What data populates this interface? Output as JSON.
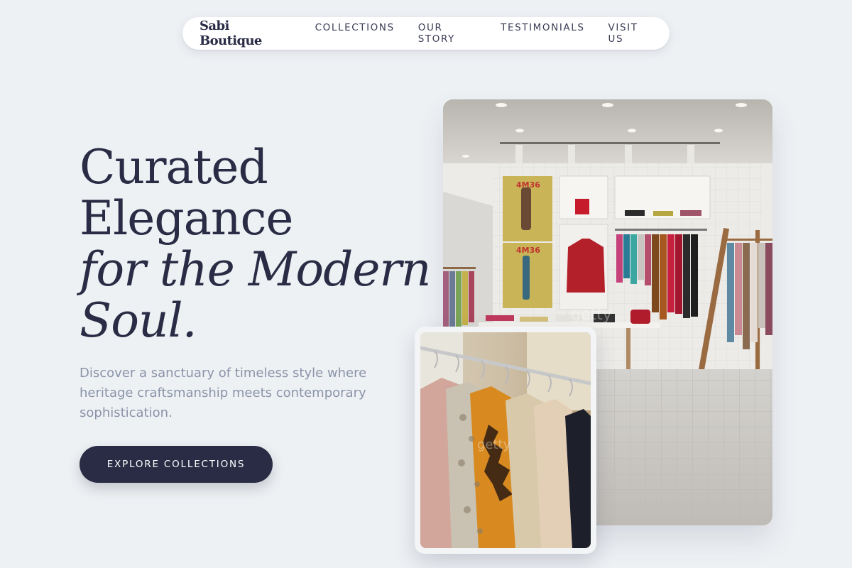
{
  "nav": {
    "brand": "Sabi Boutique",
    "links": [
      "COLLECTIONS",
      "OUR STORY",
      "TESTIMONIALS",
      "VISIT US"
    ]
  },
  "hero": {
    "title_line1": "Curated",
    "title_line2": "Elegance",
    "title_line3": "for the Modern",
    "title_line4": "Soul.",
    "subtitle": "Discover a sanctuary of timeless style where heritage craftsmanship meets contemporary sophistication.",
    "cta_label": "EXPLORE COLLECTIONS"
  },
  "images": {
    "store_poster_text": "4M36",
    "store_alt": "boutique-interior-photo",
    "rack_alt": "clothing-rack-photo"
  },
  "colors": {
    "background": "#eef1f4",
    "primary": "#2a2c45",
    "muted_text": "#8a93a8",
    "nav_bg": "#ffffff"
  }
}
